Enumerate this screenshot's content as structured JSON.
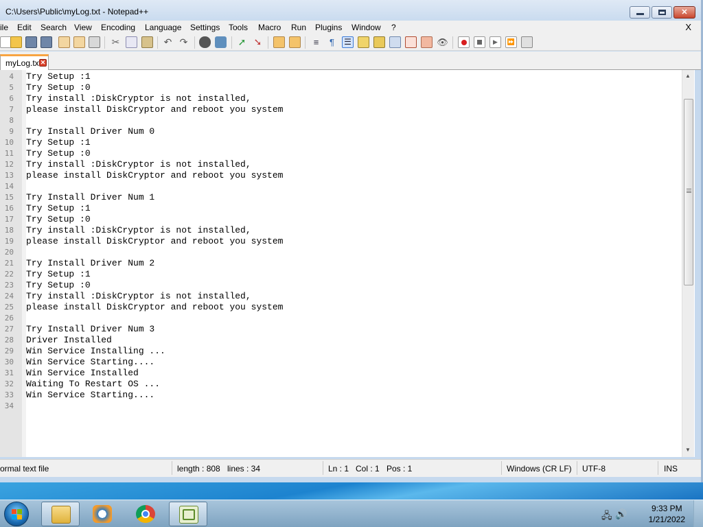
{
  "window": {
    "title": "C:\\Users\\Public\\myLog.txt - Notepad++"
  },
  "menu": {
    "items": [
      "ile",
      "Edit",
      "Search",
      "View",
      "Encoding",
      "Language",
      "Settings",
      "Tools",
      "Macro",
      "Run",
      "Plugins",
      "Window",
      "?"
    ],
    "close_label": "X"
  },
  "toolbar": {
    "icons": [
      "new-file-icon",
      "open-file-icon",
      "save-icon",
      "save-all-icon",
      "close-icon",
      "close-all-icon",
      "print-icon",
      "cut-icon",
      "copy-icon",
      "paste-icon",
      "undo-icon",
      "redo-icon",
      "find-icon",
      "replace-icon",
      "zoom-in-icon",
      "zoom-out-icon",
      "sync-vertical-icon",
      "sync-horizontal-icon",
      "word-wrap-icon",
      "show-all-chars-icon",
      "indent-guide-icon",
      "user-lang-icon",
      "doc-map-icon",
      "function-list-icon",
      "folder-workspace-icon",
      "monitor-icon",
      "record-macro-icon",
      "stop-record-icon",
      "play-macro-icon",
      "run-macro-multiple-icon",
      "save-macro-icon"
    ]
  },
  "tab": {
    "label": "myLog.txt"
  },
  "editor": {
    "lines": [
      {
        "n": "4",
        "text": "Try Setup :1"
      },
      {
        "n": "5",
        "text": "Try Setup :0"
      },
      {
        "n": "6",
        "text": "Try install :DiskCryptor is not installed,"
      },
      {
        "n": "7",
        "text": "please install DiskCryptor and reboot you system"
      },
      {
        "n": "8",
        "text": ""
      },
      {
        "n": "9",
        "text": "Try Install Driver Num 0"
      },
      {
        "n": "10",
        "text": "Try Setup :1"
      },
      {
        "n": "11",
        "text": "Try Setup :0"
      },
      {
        "n": "12",
        "text": "Try install :DiskCryptor is not installed,"
      },
      {
        "n": "13",
        "text": "please install DiskCryptor and reboot you system"
      },
      {
        "n": "14",
        "text": ""
      },
      {
        "n": "15",
        "text": "Try Install Driver Num 1"
      },
      {
        "n": "16",
        "text": "Try Setup :1"
      },
      {
        "n": "17",
        "text": "Try Setup :0"
      },
      {
        "n": "18",
        "text": "Try install :DiskCryptor is not installed,"
      },
      {
        "n": "19",
        "text": "please install DiskCryptor and reboot you system"
      },
      {
        "n": "20",
        "text": ""
      },
      {
        "n": "21",
        "text": "Try Install Driver Num 2"
      },
      {
        "n": "22",
        "text": "Try Setup :1"
      },
      {
        "n": "23",
        "text": "Try Setup :0"
      },
      {
        "n": "24",
        "text": "Try install :DiskCryptor is not installed,"
      },
      {
        "n": "25",
        "text": "please install DiskCryptor and reboot you system"
      },
      {
        "n": "26",
        "text": ""
      },
      {
        "n": "27",
        "text": "Try Install Driver Num 3"
      },
      {
        "n": "28",
        "text": "Driver Installed"
      },
      {
        "n": "29",
        "text": "Win Service Installing ..."
      },
      {
        "n": "30",
        "text": "Win Service Starting...."
      },
      {
        "n": "31",
        "text": "Win Service Installed"
      },
      {
        "n": "32",
        "text": "Waiting To Restart OS ..."
      },
      {
        "n": "33",
        "text": "Win Service Starting...."
      },
      {
        "n": "34",
        "text": ""
      }
    ]
  },
  "status": {
    "file_type": "ormal text file",
    "length": "length : 808",
    "lines": "lines : 34",
    "ln": "Ln : 1",
    "col": "Col : 1",
    "pos": "Pos : 1",
    "eol": "Windows (CR LF)",
    "encoding": "UTF-8",
    "mode": "INS"
  },
  "taskbar": {
    "apps": [
      "explorer-icon",
      "media-player-icon",
      "chrome-icon",
      "notepadpp-icon"
    ],
    "time": "9:33 PM",
    "date": "1/21/2022"
  }
}
